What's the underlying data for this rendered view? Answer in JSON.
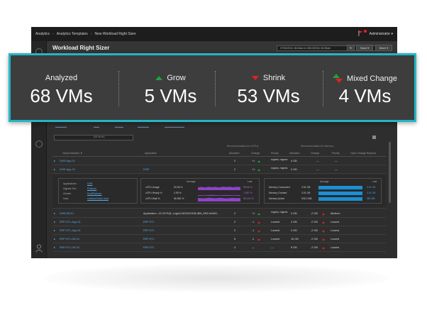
{
  "breadcrumb": {
    "items": [
      "Analytics",
      "Analytics Templates",
      "New Workload Right Sizer"
    ]
  },
  "header": {
    "user_label": "Administrator ▾"
  },
  "page": {
    "title": "Workload Right Sizer"
  },
  "toolbar": {
    "date_range": "07/09/2015, 06:30am to 08/13/2015, 06:30am",
    "refresh_icon": "refresh-icon",
    "save_label": "Save ▾",
    "more_label": "More ▾"
  },
  "summary": {
    "analyzed": {
      "label": "Analyzed",
      "value": "68 VMs"
    },
    "grow": {
      "label": "Grow",
      "value": "5 VMs",
      "icon": "arrow-up-icon"
    },
    "shrink": {
      "label": "Shrink",
      "value": "53 VMs",
      "icon": "arrow-down-icon"
    },
    "mixed": {
      "label": "Mixed Change",
      "value": "4 VMs",
      "icon": "mixed-change-icon"
    }
  },
  "search": {
    "count": "(68 items)"
  },
  "table": {
    "group_headers": {
      "vcpu": "Recommendation for vCPUs",
      "memory": "Recommendation for Memory"
    },
    "columns": [
      "Virtual Machine ▼",
      "Application",
      "Allocated",
      "Change",
      "Priority",
      "Allocated",
      "Change",
      "Priority",
      "Open Change Request"
    ],
    "rows_top": [
      {
        "vm": "DHR-App-01",
        "app": "",
        "vcpu_alloc": "2",
        "vcpu_change": "+1",
        "vcpu_priority": "Highest, Highest",
        "mem_alloc": "4 GB",
        "mem_change": "—",
        "mem_priority": "—"
      },
      {
        "vm": "DHR-App-02",
        "app": "DHR",
        "vcpu_alloc": "2",
        "vcpu_change": "+1",
        "vcpu_priority": "Highest, Highest",
        "mem_alloc": "4 GB",
        "mem_change": "—",
        "mem_priority": "—"
      }
    ],
    "rows_bottom": [
      {
        "vm": "DHR-DB-01",
        "app": "Application→ID MYSQL-Logic2-MONGODB-IBM_DB2-64469...",
        "vcpu_alloc": "2",
        "vcpu_change": "+1",
        "vcpu_priority": "Highest, Highest",
        "mem_alloc": "4 GB",
        "mem_change": "-2 GB",
        "mem_priority": "Medium"
      },
      {
        "vm": "ERP-ETL-App-01",
        "app": "ERP-ETL",
        "vcpu_alloc": "2",
        "vcpu_change": "-1",
        "vcpu_priority": "Lowest",
        "mem_alloc": "4 GB",
        "mem_change": "-2 GB",
        "mem_priority": "Lowest"
      },
      {
        "vm": "ERP-ETL-App-02",
        "app": "ERP-ETL",
        "vcpu_alloc": "2",
        "vcpu_change": "-1",
        "vcpu_priority": "Lowest",
        "mem_alloc": "4 GB",
        "mem_change": "-2 GB",
        "mem_priority": "Lowest"
      },
      {
        "vm": "ERP-ETL-DB-01",
        "app": "ERP-ETL",
        "vcpu_alloc": "8",
        "vcpu_change": "-2",
        "vcpu_priority": "Lowest",
        "mem_alloc": "16 GB",
        "mem_change": "-2 GB",
        "mem_priority": "Lowest"
      },
      {
        "vm": "ERP-ETL-DB-02",
        "app": "ERP-ETL",
        "vcpu_alloc": "4",
        "vcpu_change": "—",
        "vcpu_priority": "—",
        "mem_alloc": "8 GB",
        "mem_change": "-2 GB",
        "mem_priority": "Lowest"
      }
    ],
    "detail": {
      "info": [
        {
          "label": "Applications:",
          "value": "DHR"
        },
        {
          "label": "Highest Tier:",
          "value": "Platinum"
        },
        {
          "label": "Cluster:",
          "value": "ProdPlatinum"
        },
        {
          "label": "Host:",
          "value": "esx6dsx01Adc.local"
        }
      ],
      "cpu": {
        "avg_header": "Average",
        "last_header": "Last",
        "rows": [
          {
            "label": "vCPU Usage",
            "avg": "93.96 %",
            "last": "99.05 %"
          },
          {
            "label": "vCPU Ready %",
            "avg": "0.99 %",
            "last": "1.057 %"
          },
          {
            "label": "vCPU Wait %",
            "avg": "96.962 %",
            "last": "95.124 %"
          }
        ]
      },
      "memory": {
        "avg_header": "Average",
        "last_header": "Last",
        "rows": [
          {
            "label": "Memory Consumed",
            "avg": "3.91 GB",
            "last": "3.91 GB"
          },
          {
            "label": "Memory Granted",
            "avg": "3.91 GB",
            "last": "3.91 GB"
          },
          {
            "label": "Memory Active",
            "avg": "935.2 MB",
            "last": "980 MB"
          }
        ]
      }
    }
  },
  "colors": {
    "accent_border": "#23b6c6",
    "grow": "#1fa33c",
    "shrink": "#e62020",
    "link": "#5aa9e6",
    "cpu_bar": "#8e44c6",
    "mem_bar": "#1a8fd6"
  }
}
